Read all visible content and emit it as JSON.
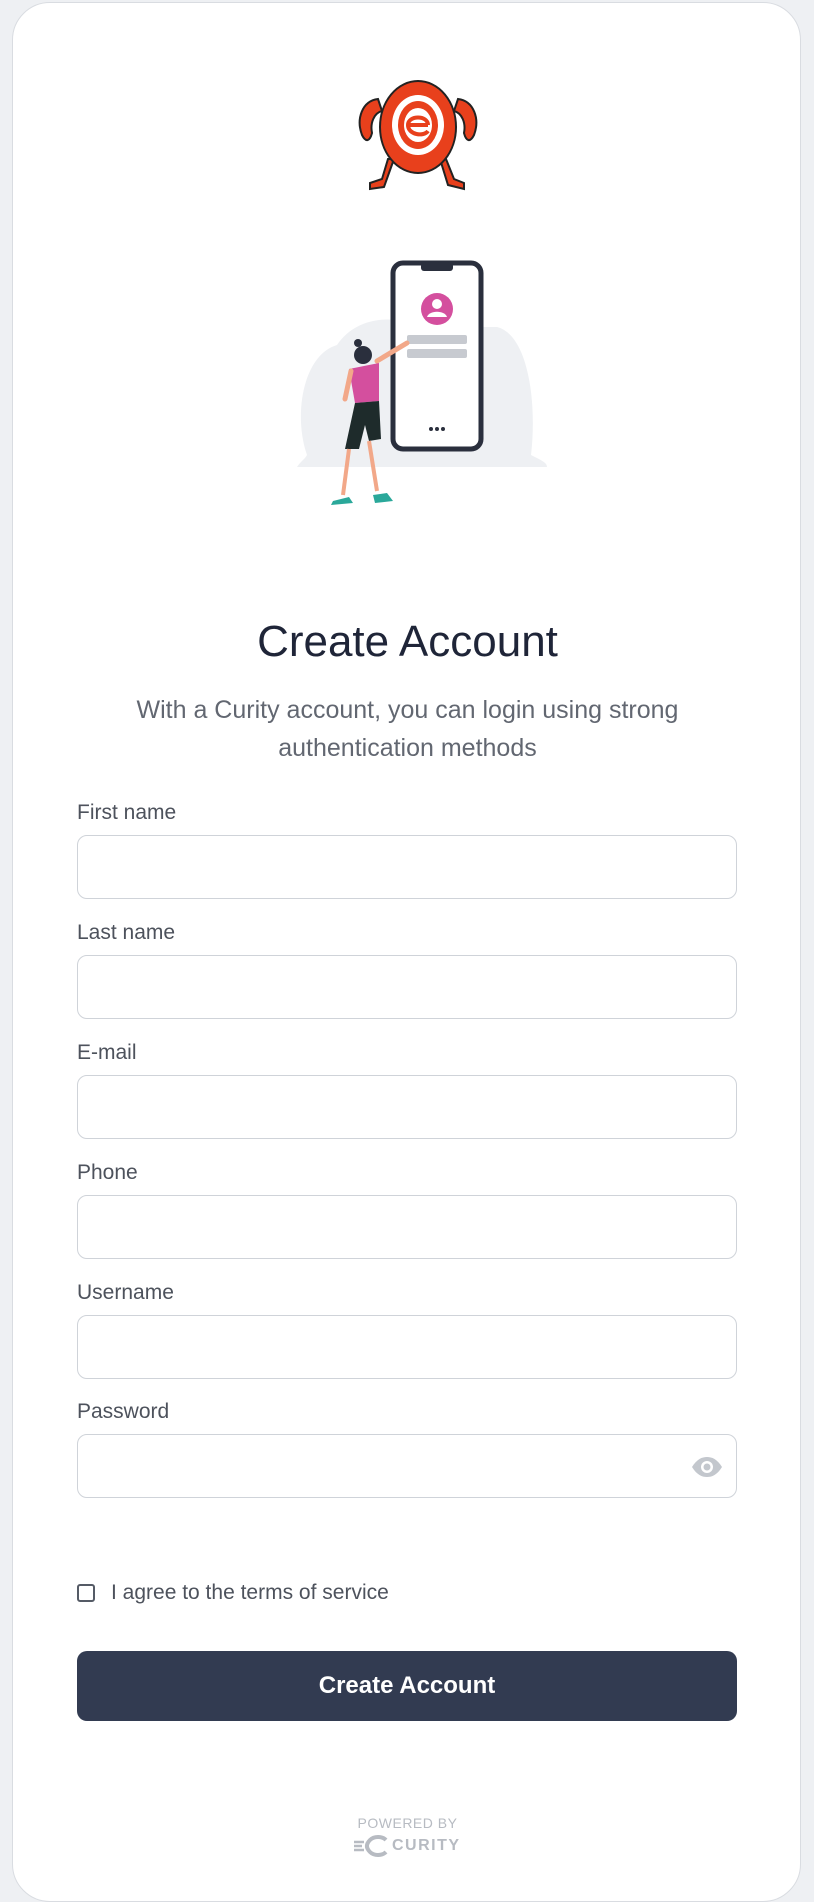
{
  "form": {
    "title": "Create Account",
    "subtitle": "With a Curity account, you can login using strong authentication methods",
    "fields": [
      {
        "label": "First name",
        "value": ""
      },
      {
        "label": "Last name",
        "value": ""
      },
      {
        "label": "E-mail",
        "value": ""
      },
      {
        "label": "Phone",
        "value": ""
      },
      {
        "label": "Username",
        "value": ""
      },
      {
        "label": "Password",
        "value": ""
      }
    ],
    "terms_label": "I agree to the terms of service",
    "terms_checked": false,
    "submit_label": "Create Account"
  },
  "footer": {
    "powered_by": "POWERED BY",
    "brand": "CURITY"
  },
  "icons": {
    "logo": "mascot-logo",
    "illustration": "phone-signup-illustration",
    "password_toggle": "eye-icon"
  },
  "colors": {
    "primary_button": "#323b51",
    "title_text": "#1f2538",
    "accent_pink": "#d44f9e",
    "logo_red": "#e8401c"
  }
}
